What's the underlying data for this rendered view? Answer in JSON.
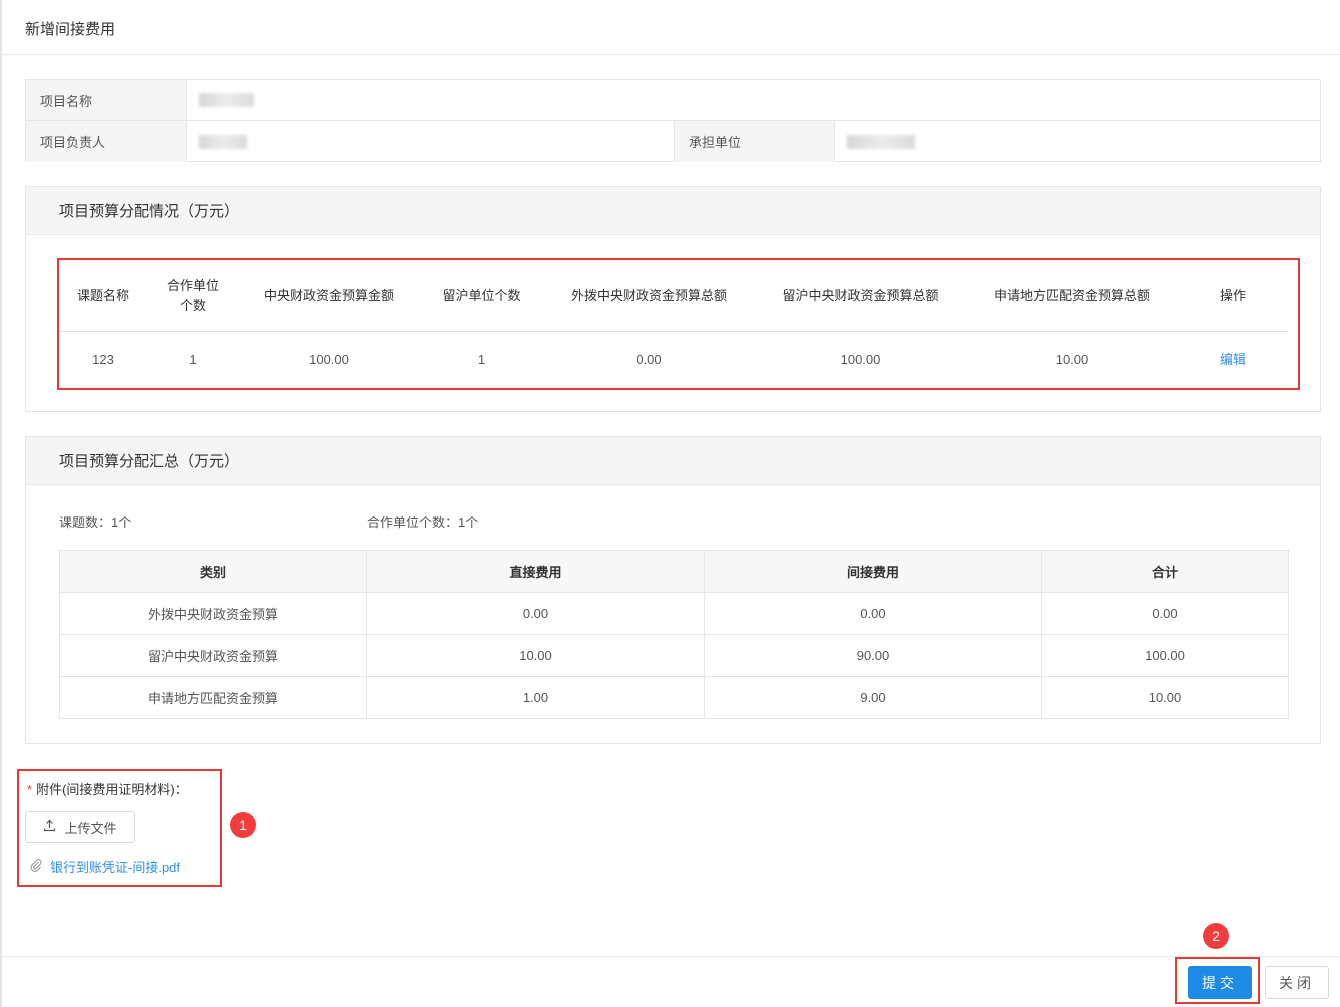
{
  "modal": {
    "title": "新增间接费用"
  },
  "info": {
    "project_name_label": "项目名称",
    "leader_label": "项目负责人",
    "unit_label": "承担单位"
  },
  "allocation": {
    "title": "项目预算分配情况（万元）",
    "headers": [
      "课题名称",
      "合作单位个数",
      "中央财政资金预算金额",
      "留沪单位个数",
      "外拨中央财政资金预算总额",
      "留沪中央财政资金预算总额",
      "申请地方匹配资金预算总额",
      "操作"
    ],
    "header_coop_line1": "合作单位",
    "header_coop_line2": "个数",
    "rows": [
      [
        "123",
        "1",
        "100.00",
        "1",
        "0.00",
        "100.00",
        "10.00",
        "编辑"
      ]
    ]
  },
  "summary": {
    "title": "项目预算分配汇总（万元）",
    "topic_count": "课题数：1个",
    "coop_count": "合作单位个数：1个",
    "headers": [
      "类别",
      "直接费用",
      "间接费用",
      "合计"
    ],
    "rows": [
      [
        "外拨中央财政资金预算",
        "0.00",
        "0.00",
        "0.00"
      ],
      [
        "留沪中央财政资金预算",
        "10.00",
        "90.00",
        "100.00"
      ],
      [
        "申请地方匹配资金预算",
        "1.00",
        "9.00",
        "10.00"
      ]
    ]
  },
  "attachment": {
    "required_mark": "*",
    "label": "附件(间接费用证明材料)：",
    "upload_label": "上传文件",
    "file_name": "银行到账凭证-间接.pdf"
  },
  "annotations": {
    "badge1": "1",
    "badge2": "2",
    "color": "#e53935"
  },
  "footer": {
    "submit_label": "提交",
    "close_label": "关闭"
  },
  "colors": {
    "primary": "#1e8be6",
    "link": "#2f8ee8"
  }
}
